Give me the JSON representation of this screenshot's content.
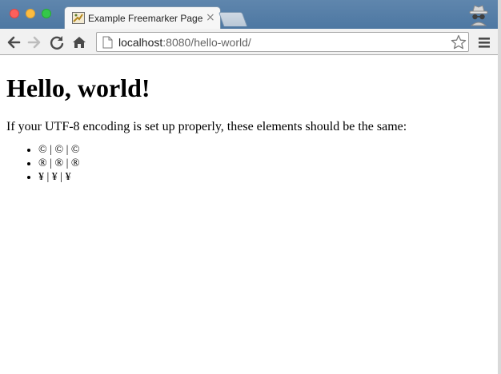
{
  "browser": {
    "tab": {
      "title": "Example Freemarker Page",
      "close_glyph": "×"
    },
    "address_bar": {
      "url_host": "localhost",
      "url_rest": ":8080/hello-world/"
    },
    "icons": {
      "back": "back-arrow-icon",
      "forward": "forward-arrow-icon",
      "reload": "reload-icon",
      "home": "home-icon",
      "page": "page-icon",
      "bookmark": "star-icon",
      "menu": "hamburger-menu-icon",
      "profile": "incognito-icon"
    },
    "colors": {
      "titlebar": "#5a82aa",
      "toolbar": "#f1f1f1",
      "close": "#fc605c",
      "minimize": "#fdbc40",
      "maximize": "#34c84a"
    }
  },
  "page": {
    "heading": "Hello, world!",
    "intro": "If your UTF-8 encoding is set up properly, these elements should be the same:",
    "items": [
      "© | © | ©",
      "® | ® | ®",
      "¥ | ¥ | ¥"
    ]
  }
}
